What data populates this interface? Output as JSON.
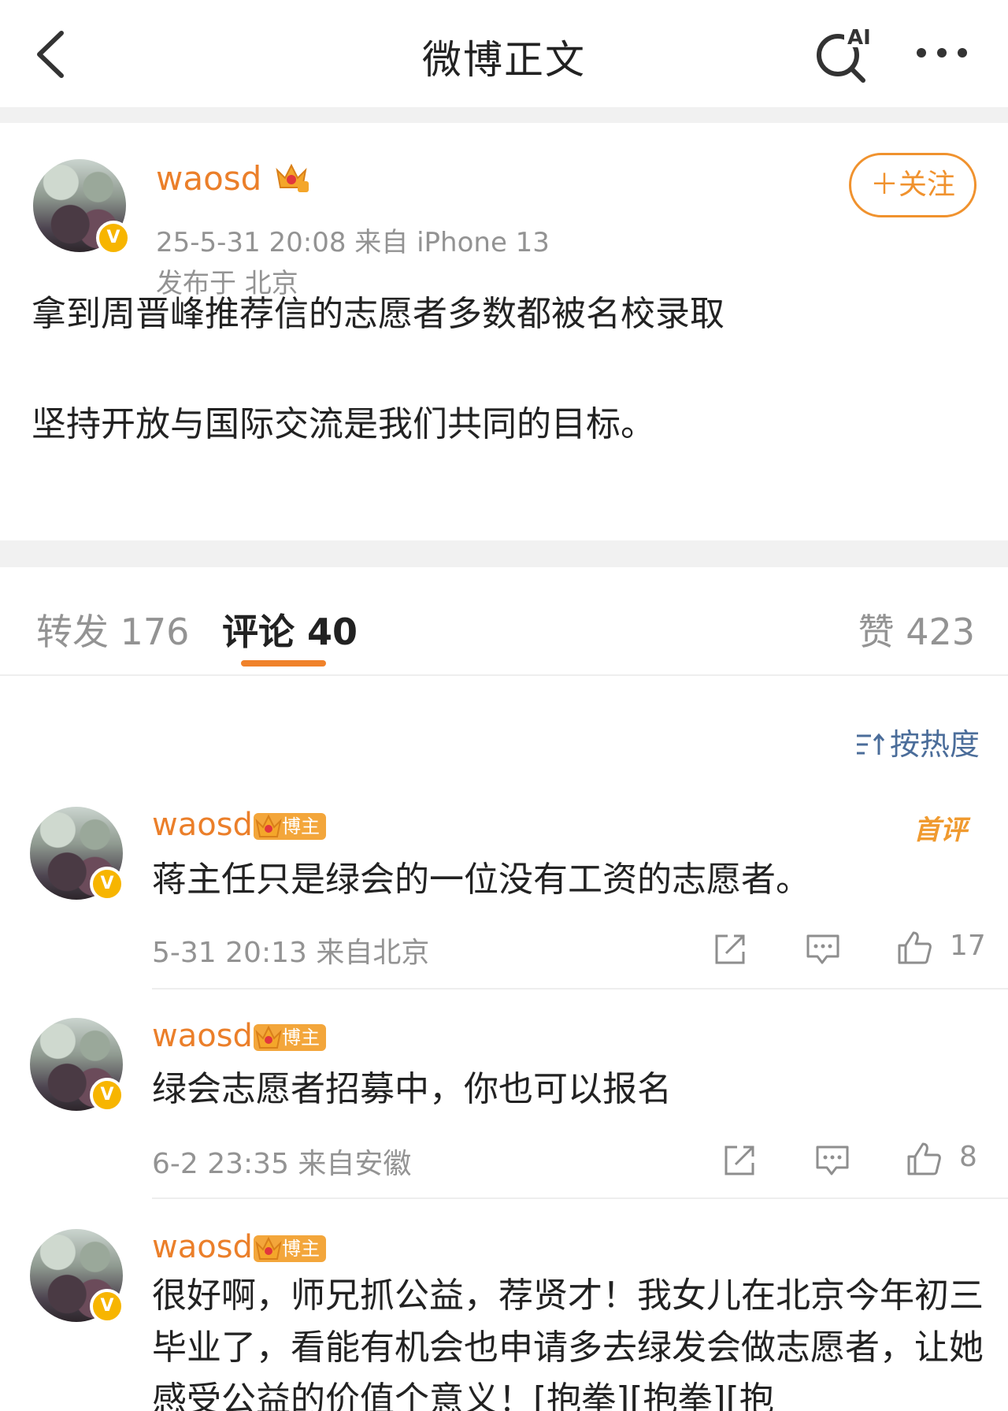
{
  "header": {
    "title": "微博正文",
    "ai_label": "AI",
    "back_icon": "chevron-left-icon",
    "search_icon": "ai-search-icon",
    "more_icon": "more-dots-icon"
  },
  "post": {
    "author": "waosd",
    "verified_mark": "V",
    "time_source": "25-5-31 20:08   来自 iPhone 13",
    "location": "发布于 北京",
    "follow_label": "＋关注",
    "text_line1": "拿到周晋峰推荐信的志愿者多数都被名校录取",
    "text_line2": "坚持开放与国际交流是我们共同的目标。"
  },
  "tabs": {
    "repost": "转发 176",
    "comments": "评论 40",
    "likes": "赞 423"
  },
  "sort_label": "按热度",
  "comments": [
    {
      "name": "waosd",
      "badge": "博主",
      "first_label": "首评",
      "text": "蒋主任只是绿会的一位没有工资的志愿者。",
      "meta": "5-31 20:13  来自北京",
      "likes": "17"
    },
    {
      "name": "waosd",
      "badge": "博主",
      "text": "绿会志愿者招募中，你也可以报名",
      "meta": "6-2 23:35  来自安徽",
      "likes": "8"
    },
    {
      "name": "waosd",
      "badge": "博主",
      "text": "很好啊，师兄抓公益，荐贤才！我女儿在北京今年初三毕业了，看能有机会也申请多去绿发会做志愿者，让她感受公益的价值个意义！[抱拳][抱拳][抱"
    }
  ],
  "colors": {
    "accent_orange": "#eb7f2a",
    "link_blue": "#4b6d9a",
    "gold": "#f7b500"
  }
}
